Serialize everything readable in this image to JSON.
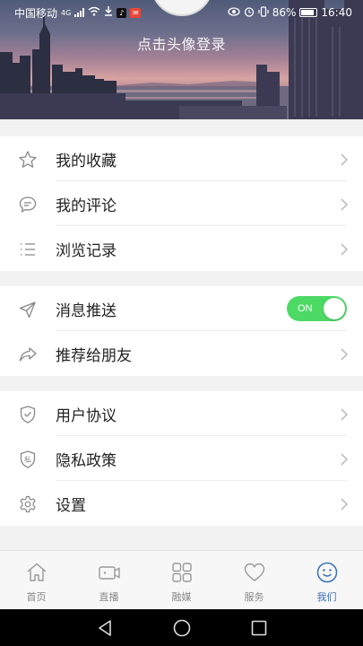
{
  "status_bar": {
    "carrier": "中国移动",
    "network": "4G",
    "battery": "86%",
    "time": "16:40",
    "icons": [
      "signal-icon",
      "wifi-icon",
      "download-icon",
      "tiktok-icon",
      "app-notification-icon",
      "eye-icon",
      "alarm-icon",
      "vibrate-icon",
      "battery-icon"
    ]
  },
  "profile": {
    "login_prompt": "点击头像登录"
  },
  "menu_groups": [
    [
      {
        "label": "我的收藏",
        "icon": "star-icon"
      },
      {
        "label": "我的评论",
        "icon": "comment-icon"
      },
      {
        "label": "浏览记录",
        "icon": "list-icon"
      }
    ],
    [
      {
        "label": "消息推送",
        "icon": "send-icon",
        "toggle": "ON",
        "toggle_on": true
      },
      {
        "label": "推荐给朋友",
        "icon": "share-icon"
      }
    ],
    [
      {
        "label": "用户协议",
        "icon": "shield-check-icon"
      },
      {
        "label": "隐私政策",
        "icon": "privacy-shield-icon",
        "icon_text": "私"
      },
      {
        "label": "设置",
        "icon": "gear-icon"
      }
    ]
  ],
  "tabs": [
    {
      "label": "首页",
      "icon": "home-icon",
      "active": false
    },
    {
      "label": "直播",
      "icon": "live-camera-icon",
      "active": false
    },
    {
      "label": "融媒",
      "icon": "grid-icon",
      "active": false
    },
    {
      "label": "服务",
      "icon": "heart-icon",
      "active": false
    },
    {
      "label": "我们",
      "icon": "smiley-icon",
      "active": true
    }
  ],
  "colors": {
    "accent": "#3a6fb6",
    "toggle_on": "#4cd964",
    "inactive": "#888888"
  }
}
